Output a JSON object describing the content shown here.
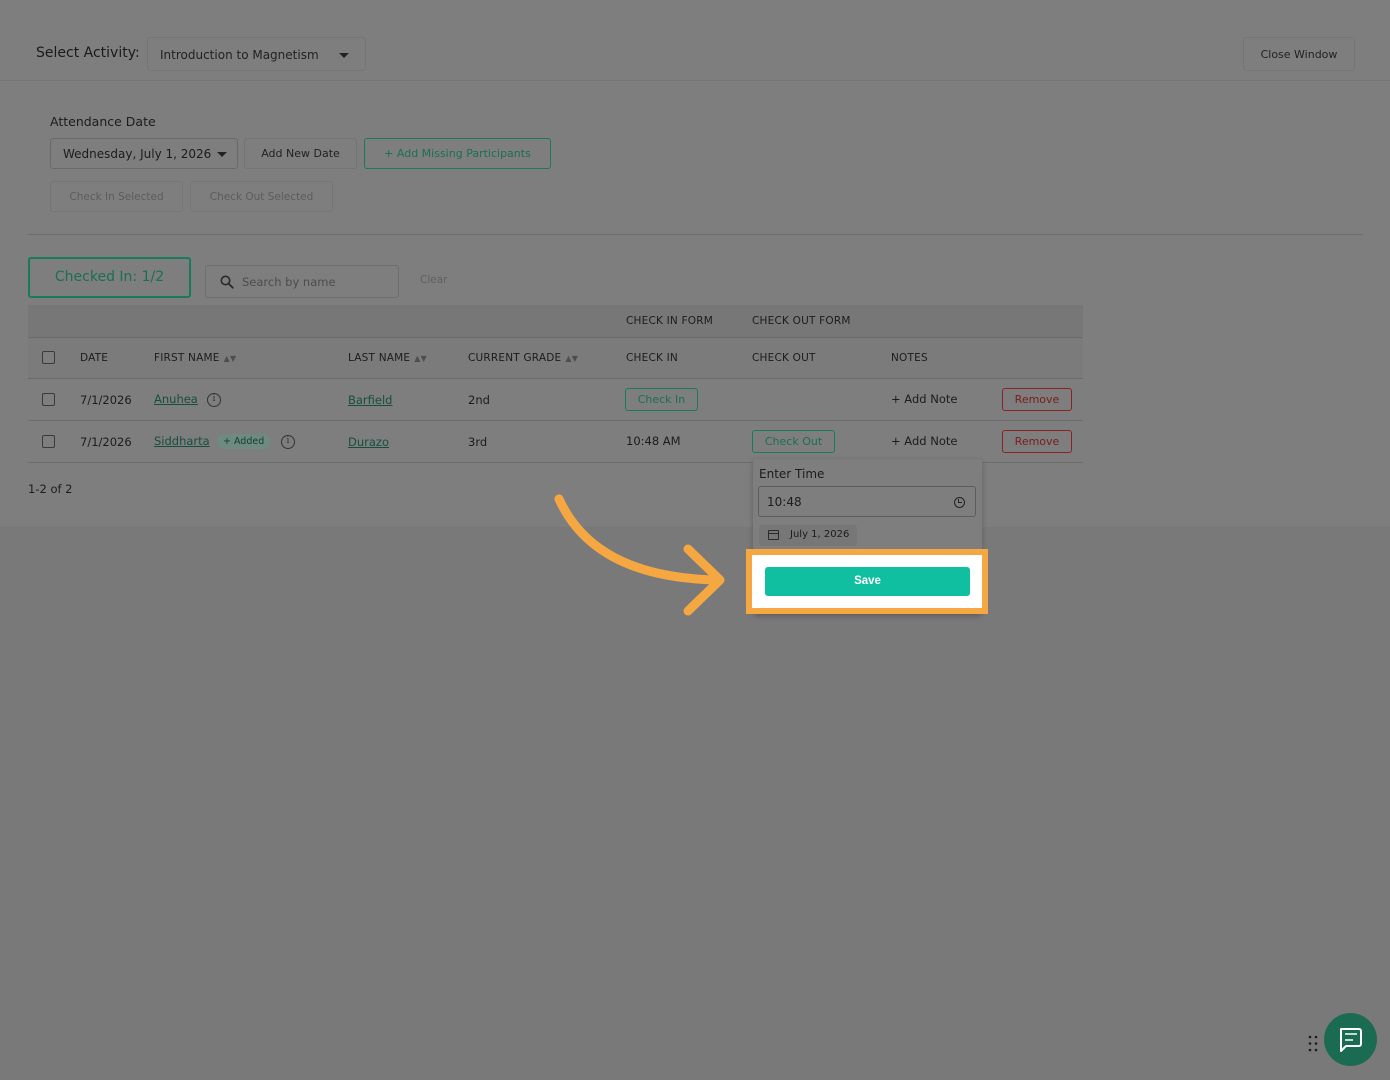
{
  "header": {
    "select_label": "Select Activity:",
    "activity": "Introduction to Magnetism",
    "close_label": "Close Window"
  },
  "attendance": {
    "date_label": "Attendance Date",
    "date_value": "Wednesday, July 1, 2026",
    "add_new_date": "Add New Date",
    "add_missing": "+ Add Missing Participants",
    "check_in_selected": "Check In Selected",
    "check_out_selected": "Check Out Selected"
  },
  "summary": {
    "checked_in": "Checked In: 1/2",
    "search_placeholder": "Search by name",
    "clear": "Clear"
  },
  "table": {
    "group_headers": {
      "check_in_form": "CHECK IN FORM",
      "check_out_form": "CHECK OUT FORM"
    },
    "headers": {
      "date": "DATE",
      "first_name": "FIRST NAME",
      "last_name": "LAST NAME",
      "grade": "CURRENT GRADE",
      "check_in": "CHECK IN",
      "check_out": "CHECK OUT",
      "notes": "NOTES"
    },
    "rows": [
      {
        "date": "7/1/2026",
        "first_name": "Anuhea",
        "last_name": "Barfield",
        "grade": "2nd",
        "check_in": "Check In",
        "check_out": "",
        "notes": "+ Add Note",
        "remove": "Remove"
      },
      {
        "date": "7/1/2026",
        "first_name": "Siddharta",
        "badge": "+ Added",
        "last_name": "Durazo",
        "grade": "3rd",
        "check_in": "10:48 AM",
        "check_out": "Check Out",
        "notes": "+ Add Note",
        "remove": "Remove"
      }
    ],
    "pagination": "1-2 of 2"
  },
  "popover": {
    "label": "Enter Time",
    "time": "10:48",
    "date": "July 1, 2026",
    "save": "Save"
  },
  "colors": {
    "accent": "#10bfa0",
    "highlight": "#f5a742",
    "brand_green": "#1a7a5e",
    "danger": "#8a2424"
  }
}
